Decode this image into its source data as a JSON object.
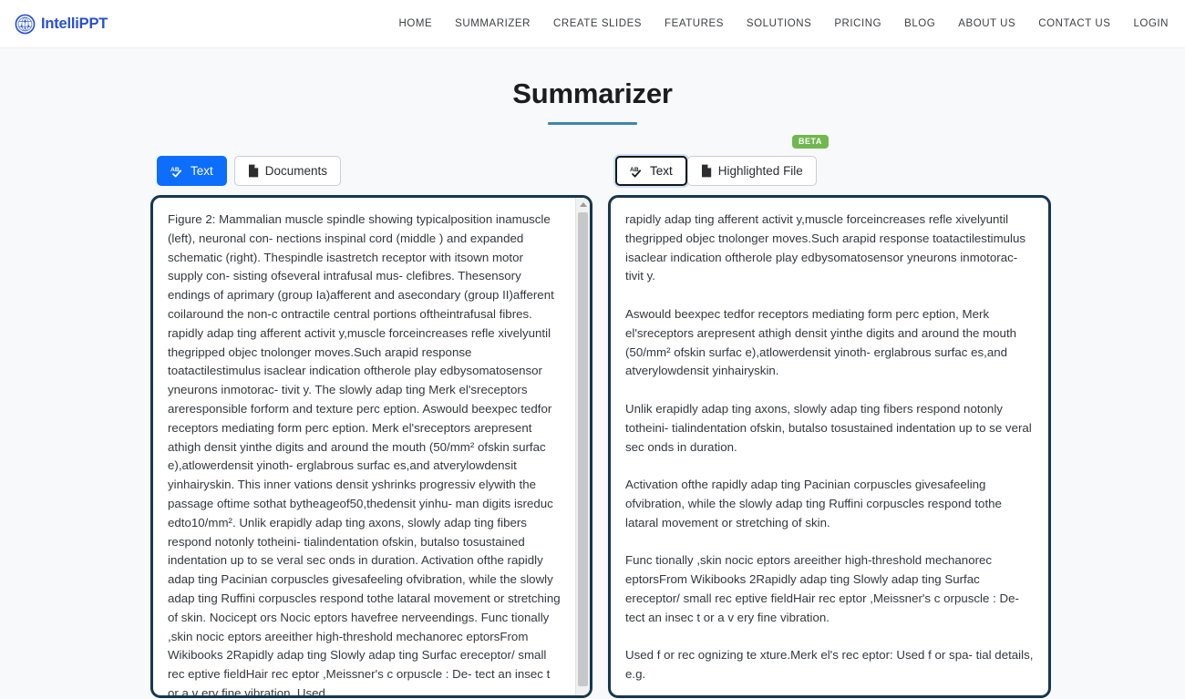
{
  "brand": {
    "name": "IntelliPPT",
    "logo_icon": "globe-network-icon",
    "color": "#2b4fd1"
  },
  "nav": {
    "items": [
      {
        "label": "HOME",
        "name": "nav-home"
      },
      {
        "label": "SUMMARIZER",
        "name": "nav-summarizer"
      },
      {
        "label": "CREATE SLIDES",
        "name": "nav-create-slides"
      },
      {
        "label": "FEATURES",
        "name": "nav-features"
      },
      {
        "label": "SOLUTIONS",
        "name": "nav-solutions"
      },
      {
        "label": "PRICING",
        "name": "nav-pricing"
      },
      {
        "label": "BLOG",
        "name": "nav-blog"
      },
      {
        "label": "ABOUT US",
        "name": "nav-about-us"
      },
      {
        "label": "CONTACT US",
        "name": "nav-contact-us"
      },
      {
        "label": "LOGIN",
        "name": "nav-login"
      }
    ]
  },
  "page": {
    "title": "Summarizer",
    "rule_color": "#3d87b0"
  },
  "input_tabs": {
    "text": {
      "label": "Text",
      "icon": "spellcheck-ab-icon",
      "active": true
    },
    "documents": {
      "label": "Documents",
      "icon": "document-file-icon",
      "active": false
    }
  },
  "output_tabs": {
    "text": {
      "label": "Text",
      "icon": "spellcheck-ab-icon",
      "active": true
    },
    "highlighted_file": {
      "label": "Highlighted File",
      "icon": "document-file-icon",
      "badge": "BETA",
      "badge_color": "#70b84e",
      "active": false
    }
  },
  "input_panel": {
    "content": "Figure 2: Mammalian muscle spindle showing typicalposition inamuscle (left), neuronal con- nections inspinal cord (middle ) and expanded schematic (right). Thespindle isastretch receptor with itsown motor supply con- sisting ofseveral intrafusal mus- clefibres. Thesensory endings of aprimary (group Ia)afferent and asecondary (group II)afferent coilaround the non-c ontractile central portions oftheintrafusal fibres. rapidly adap ting afferent activit y,muscle forceincreases refle xivelyuntil thegripped objec tnolonger moves.Such arapid response toatactilestimulus isaclear indication oftherole play edbysomatosensor yneurons inmotorac- tivit y. The slowly adap ting Merk el'sreceptors areresponsible forform and texture perc eption. Aswould beexpec tedfor receptors mediating form perc eption. Merk el'sreceptors arepresent athigh densit yinthe digits and around the mouth (50/mm² ofskin surfac e),atlowerdensit yinoth- erglabrous surfac es,and atverylowdensit yinhairyskin. This inner vations densit yshrinks progressiv elywith the passage oftime sothat bytheageof50,thedensit yinhu- man digits isreduc edto10/mm². Unlik erapidly adap ting axons, slowly adap ting fibers respond notonly totheini- tialindentation ofskin, butalso tosustained indentation up to se veral sec onds in duration. Activation ofthe rapidly adap ting Pacinian corpuscles givesafeeling ofvibration, while the slowly adap ting Ruffini corpuscles respond tothe lataral movement or stretching of skin. Nocicept ors Nocic eptors havefree nerveendings. Func tionally ,skin nocic eptors areeither high-threshold mechanorec eptorsFrom Wikibooks 2Rapidly adap ting Slowly adap ting Surfac ereceptor/ small rec eptive fieldHair rec eptor ,Meissner's c orpuscle : De- tect an insec t or a v ery fine vibration. Used",
    "scrollbar": {
      "visible": true,
      "up_arrow_icon": "chevron-up-icon"
    }
  },
  "output_panel": {
    "content": "rapidly adap ting afferent activit y,muscle forceincreases refle xivelyuntil thegripped objec tnolonger moves.Such arapid response toatactilestimulus isaclear indication oftherole play edbysomatosensor yneurons inmotorac- tivit y.\n\nAswould beexpec tedfor receptors mediating form perc eption, Merk el'sreceptors arepresent athigh densit yinthe digits and around the mouth (50/mm² ofskin surfac e),atlowerdensit yinoth- erglabrous surfac es,and atverylowdensit yinhairyskin.\n\nUnlik erapidly adap ting axons, slowly adap ting fibers respond notonly totheini- tialindentation ofskin, butalso tosustained indentation up to se veral sec onds in duration.\n\nActivation ofthe rapidly adap ting Pacinian corpuscles givesafeeling ofvibration, while the slowly adap ting Ruffini corpuscles respond tothe lataral movement or stretching of skin.\n\nFunc tionally ,skin nocic eptors areeither high-threshold mechanorec eptorsFrom Wikibooks 2Rapidly adap ting Slowly adap ting Surfac ereceptor/ small rec eptive fieldHair rec eptor ,Meissner's c orpuscle : De- tect an insec t or a v ery fine vibration.\n\nUsed f or rec ognizing te xture.Merk el's rec eptor: Used f or spa- tial details, e.g."
  }
}
